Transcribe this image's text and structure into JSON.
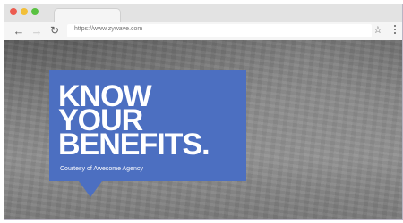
{
  "browser": {
    "url": "https://www.zywave.com",
    "icons": {
      "back": "arrow-left-icon",
      "forward": "arrow-right-icon",
      "reload": "reload-icon",
      "bookmark": "star-icon",
      "menu": "kebab-menu-icon"
    }
  },
  "hero": {
    "headline_line1": "KNOW",
    "headline_line2": "YOUR",
    "headline_line3": "BENEFITS.",
    "courtesy": "Courtesy of Awesome Agency"
  },
  "colors": {
    "banner": "#4c6fc1",
    "traffic_red": "#ec5b4f",
    "traffic_yellow": "#f2bf38",
    "traffic_green": "#58c140"
  }
}
